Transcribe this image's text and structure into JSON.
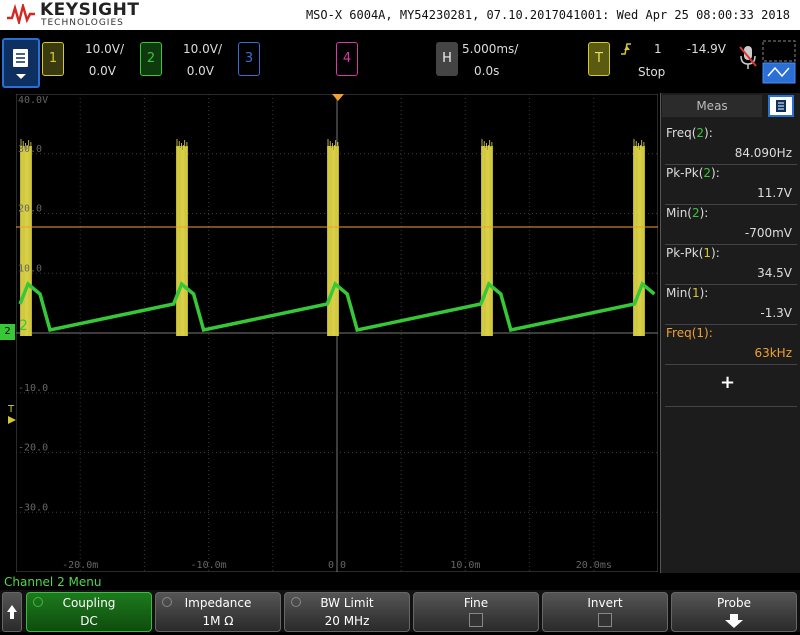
{
  "header": {
    "brand": "KEYSIGHT",
    "brand_sub": "TECHNOLOGIES",
    "device_info": "MSO-X 6004A, MY54230281, 07.10.2017041001: Wed Apr 25 08:00:33 2018"
  },
  "channels": [
    {
      "num": "1",
      "scale": "10.0V/",
      "offset": "0.0V",
      "color": "#d6c832"
    },
    {
      "num": "2",
      "scale": "10.0V/",
      "offset": "0.0V",
      "color": "#36c836"
    },
    {
      "num": "3",
      "scale": "",
      "offset": "",
      "color": "#3a6ed6"
    },
    {
      "num": "4",
      "scale": "",
      "offset": "",
      "color": "#d63aa8"
    }
  ],
  "horizontal": {
    "label": "H",
    "scale": "5.000ms/",
    "delay": "0.0s"
  },
  "trigger": {
    "label": "T",
    "source": "1",
    "level": "-14.9V",
    "state": "Stop"
  },
  "graticule": {
    "y_labels": [
      "40.0V",
      "30.0",
      "20.0",
      "10.0",
      "",
      "-10.0",
      "-20.0",
      "-30.0"
    ],
    "x_labels": [
      "-20.0m",
      "-10.0m",
      "0.0",
      "10.0m",
      "20.0ms"
    ],
    "ch2_marker": "2",
    "trig_marker": "T"
  },
  "meas": {
    "tab": "Meas",
    "items": [
      {
        "name": "Freq",
        "ch": "2",
        "value": "84.090Hz",
        "ch_color": "#36c836",
        "highlight": false
      },
      {
        "name": "Pk-Pk",
        "ch": "2",
        "value": "11.7V",
        "ch_color": "#36c836",
        "highlight": false
      },
      {
        "name": "Min",
        "ch": "2",
        "value": "-700mV",
        "ch_color": "#36c836",
        "highlight": false
      },
      {
        "name": "Pk-Pk",
        "ch": "1",
        "value": "34.5V",
        "ch_color": "#d6c832",
        "highlight": false
      },
      {
        "name": "Min",
        "ch": "1",
        "value": "-1.3V",
        "ch_color": "#d6c832",
        "highlight": false
      },
      {
        "name": "Freq",
        "ch": "1",
        "value": "63kHz",
        "ch_color": "#d6c832",
        "highlight": true
      }
    ],
    "add": "+"
  },
  "menu": {
    "title": "Channel 2 Menu",
    "keys": [
      {
        "title": "Coupling",
        "value": "DC"
      },
      {
        "title": "Impedance",
        "value": "1M Ω"
      },
      {
        "title": "BW Limit",
        "value": "20 MHz"
      },
      {
        "title": "Fine",
        "value": ""
      },
      {
        "title": "Invert",
        "value": ""
      },
      {
        "title": "Probe",
        "value": ""
      }
    ]
  },
  "colors": {
    "ch1": "#d6c832",
    "ch2": "#36c836",
    "accent": "#2a6fd6",
    "highlight": "#f0a030"
  }
}
